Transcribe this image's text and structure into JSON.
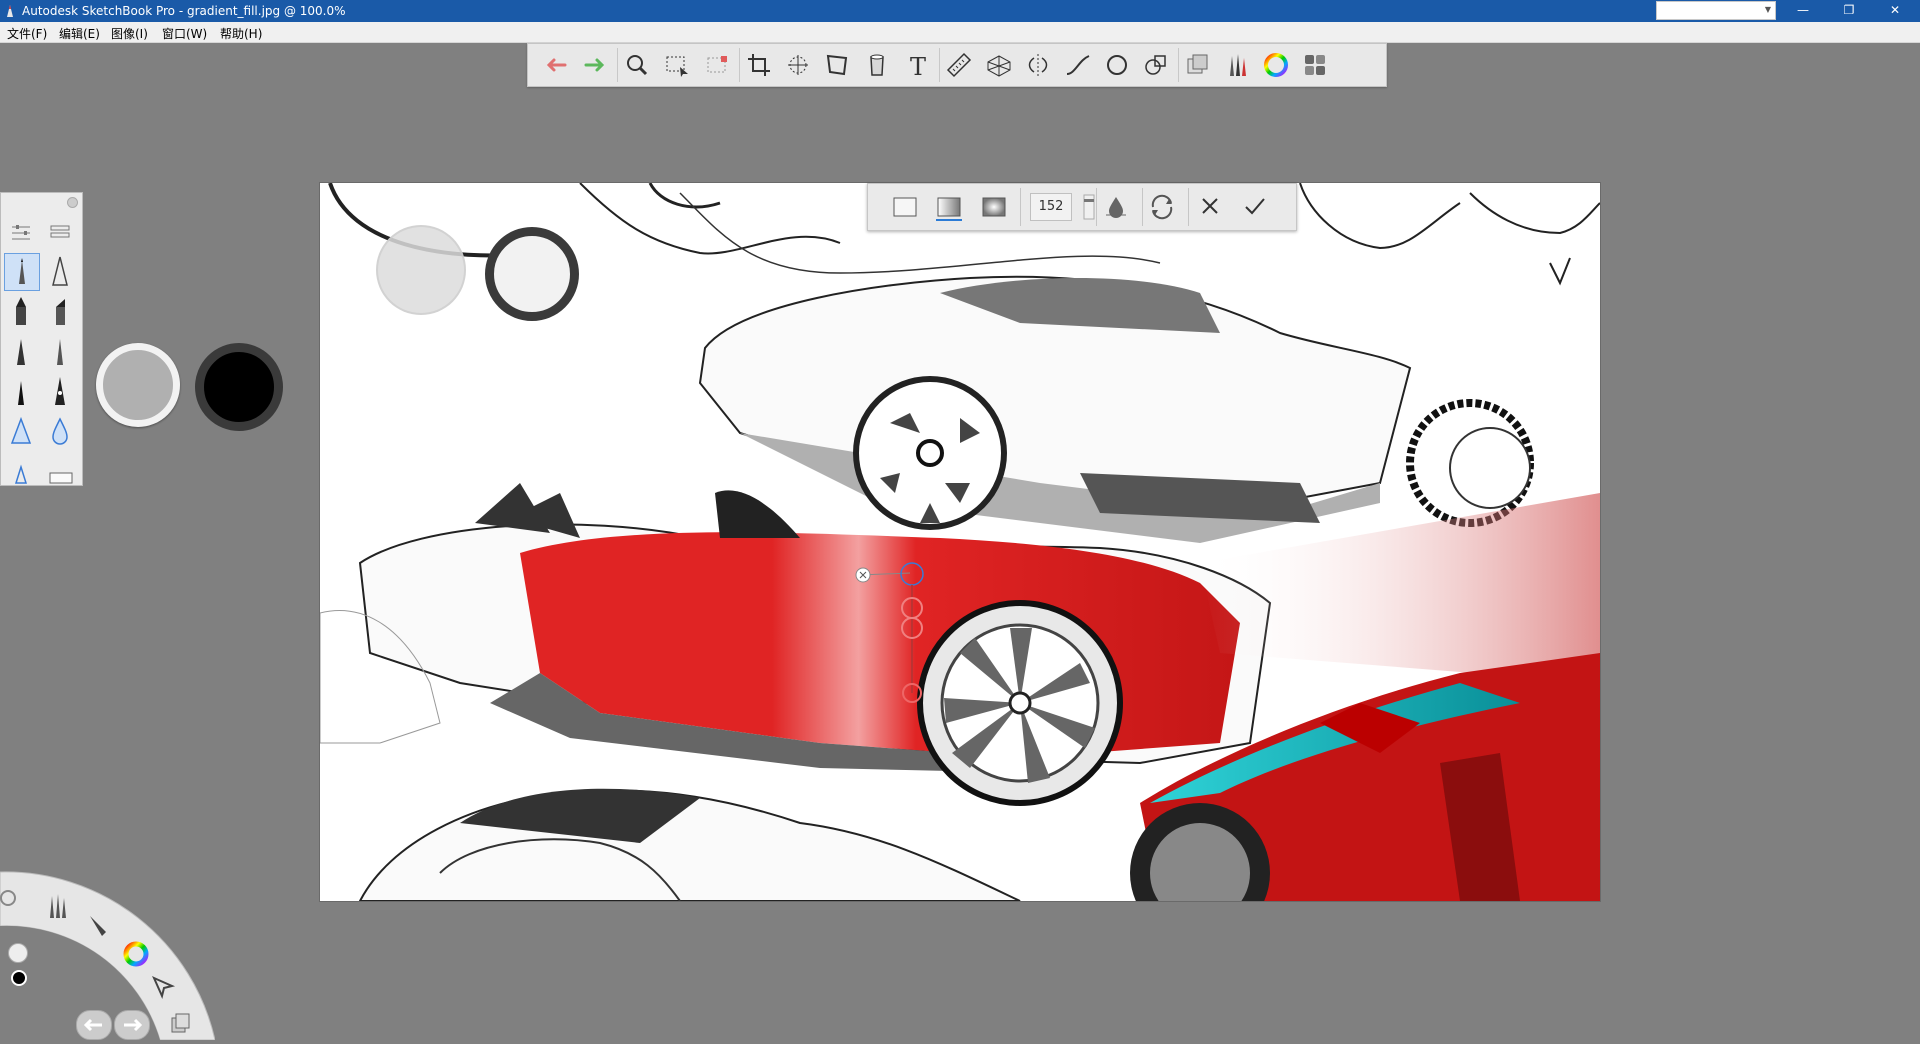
{
  "window": {
    "title": "Autodesk SketchBook Pro - gradient_fill.jpg @ 100.0%",
    "combo_value": "",
    "min_glyph": "—",
    "restore_glyph": "❐",
    "close_glyph": "✕"
  },
  "menu": {
    "file": "文件(F)",
    "edit": "编辑(E)",
    "image": "图像(I)",
    "window": "窗口(W)",
    "help": "帮助(H)"
  },
  "toolbar": {
    "items": [
      "undo-icon",
      "redo-icon",
      "zoom-icon",
      "select-icon",
      "lasso-icon",
      "crop-icon",
      "transform-icon",
      "distort-icon",
      "fill-icon",
      "text-icon",
      "ruler-icon",
      "perspective-icon",
      "symmetry-icon",
      "curve-icon",
      "ellipse-icon",
      "shapes-icon",
      "layers-icon",
      "brushes-icon",
      "color-wheel-icon",
      "panels-icon"
    ]
  },
  "fill_bar": {
    "size_value": "152",
    "mode_options": [
      "solid",
      "linear-gradient",
      "radial-gradient"
    ],
    "selected_mode": "linear-gradient"
  },
  "colors": {
    "accent": "#1a5aa8",
    "primary_color": "#000000",
    "secondary_color": "#b0b0b0",
    "gradient_red": "#e12222"
  },
  "canvas": {
    "subject": "car sketches with red gradient fill"
  }
}
